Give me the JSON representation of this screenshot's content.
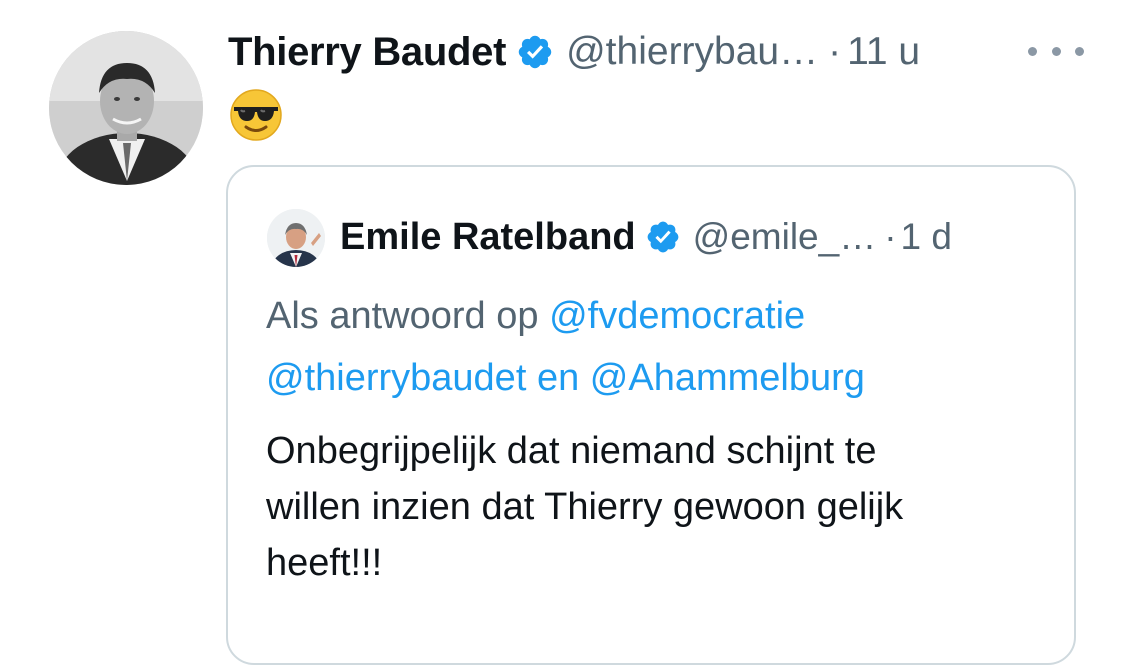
{
  "tweet": {
    "author_name": "Thierry Baudet",
    "handle": "@thierrybau…",
    "separator": "·",
    "time": "11 u",
    "emoji_icon": "smiling-face-with-sunglasses",
    "accent_color": "#1d9bf0"
  },
  "quoted": {
    "author_name": "Emile Ratelband",
    "handle": "@emile_…",
    "separator": "·",
    "time": "1 d",
    "reply_prefix": "Als antwoord op",
    "mentions": [
      "@fvdemocratie",
      "@thierrybaudet",
      "@Ahammelburg"
    ],
    "conjunction": "en",
    "body_lines": [
      "Onbegrijpelijk dat niemand schijnt te",
      "willen inzien dat Thierry gewoon gelijk",
      "heeft!!!"
    ]
  }
}
